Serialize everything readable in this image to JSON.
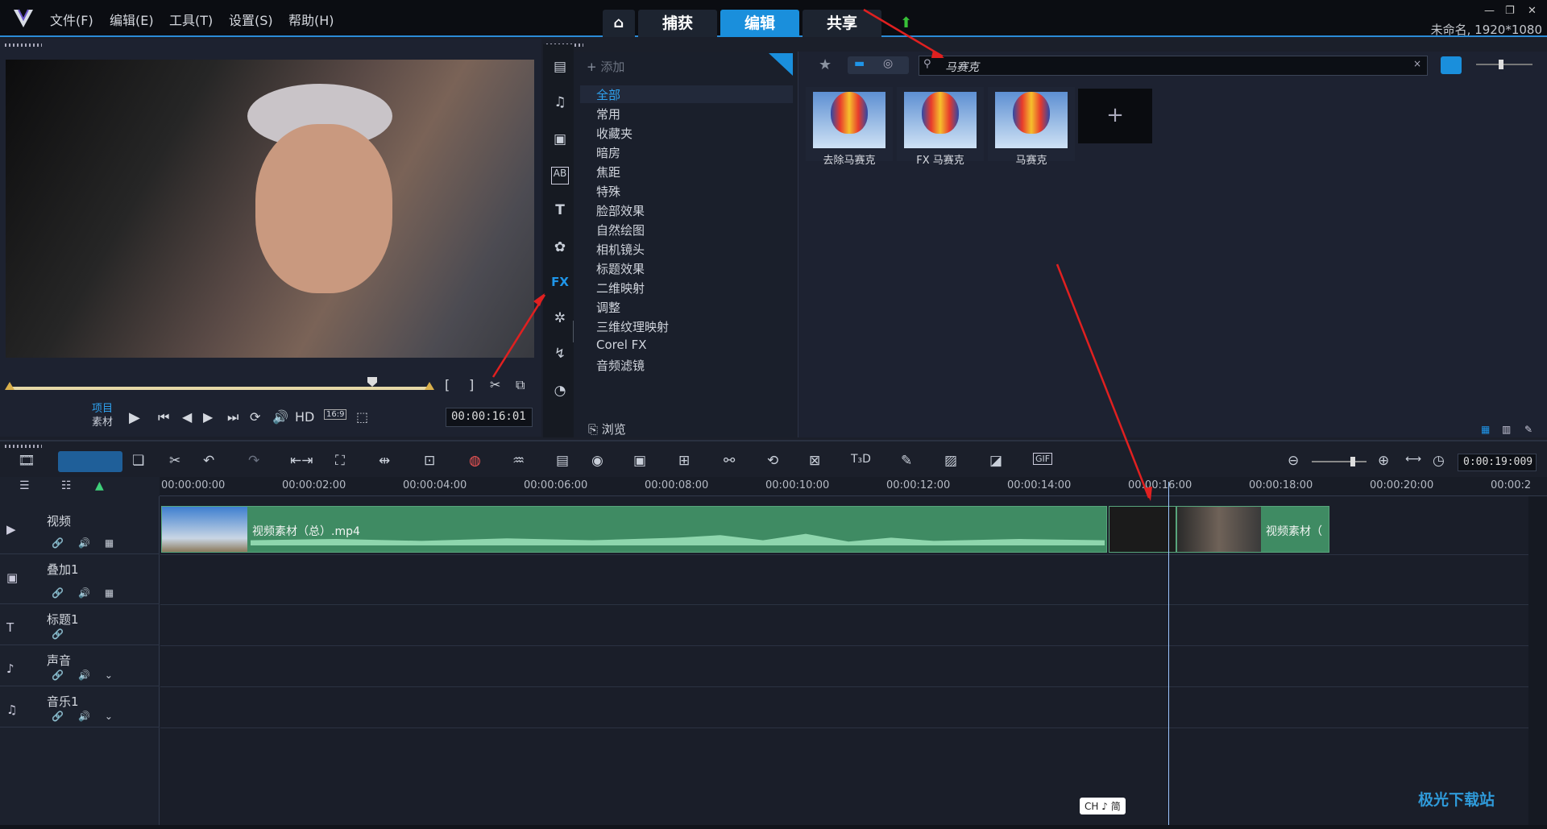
{
  "menubar": {
    "items": [
      "文件(F)",
      "编辑(E)",
      "工具(T)",
      "设置(S)",
      "帮助(H)"
    ],
    "tabs": [
      "捕获",
      "编辑",
      "共享"
    ],
    "active_tab": "编辑",
    "project_label": "未命名, 1920*1080"
  },
  "preview": {
    "mode_project": "项目",
    "mode_clip": "素材",
    "hd": "HD",
    "aspect": "16:9",
    "timecode": "00:00:16:01"
  },
  "library": {
    "add_label": "添加",
    "tooltip": "滤镜",
    "categories": [
      "全部",
      "常用",
      "收藏夹",
      "暗房",
      "焦距",
      "特殊",
      "脸部效果",
      "自然绘图",
      "相机镜头",
      "标题效果",
      "二维映射",
      "调整",
      "三维纹理映射",
      "Corel FX",
      "音频滤镜"
    ],
    "active_category": "全部",
    "browse_label": "浏览",
    "search_value": "马赛克",
    "results": [
      "去除马赛克",
      "FX 马赛克",
      "马赛克"
    ]
  },
  "timeline": {
    "timecode": "0:00:19:009",
    "ruler": [
      "00:00:00:00",
      "00:00:02:00",
      "00:00:04:00",
      "00:00:06:00",
      "00:00:08:00",
      "00:00:10:00",
      "00:00:12:00",
      "00:00:14:00",
      "00:00:16:00",
      "00:00:18:00",
      "00:00:20:00",
      "00:00:2"
    ],
    "tracks": [
      "视频",
      "叠加1",
      "标题1",
      "声音",
      "音乐1"
    ],
    "clip_main": "视频素材（总）.mp4",
    "clip_tail": "视频素材（"
  },
  "ime_label": "CH ♪ 简",
  "watermark": "极光下载站"
}
